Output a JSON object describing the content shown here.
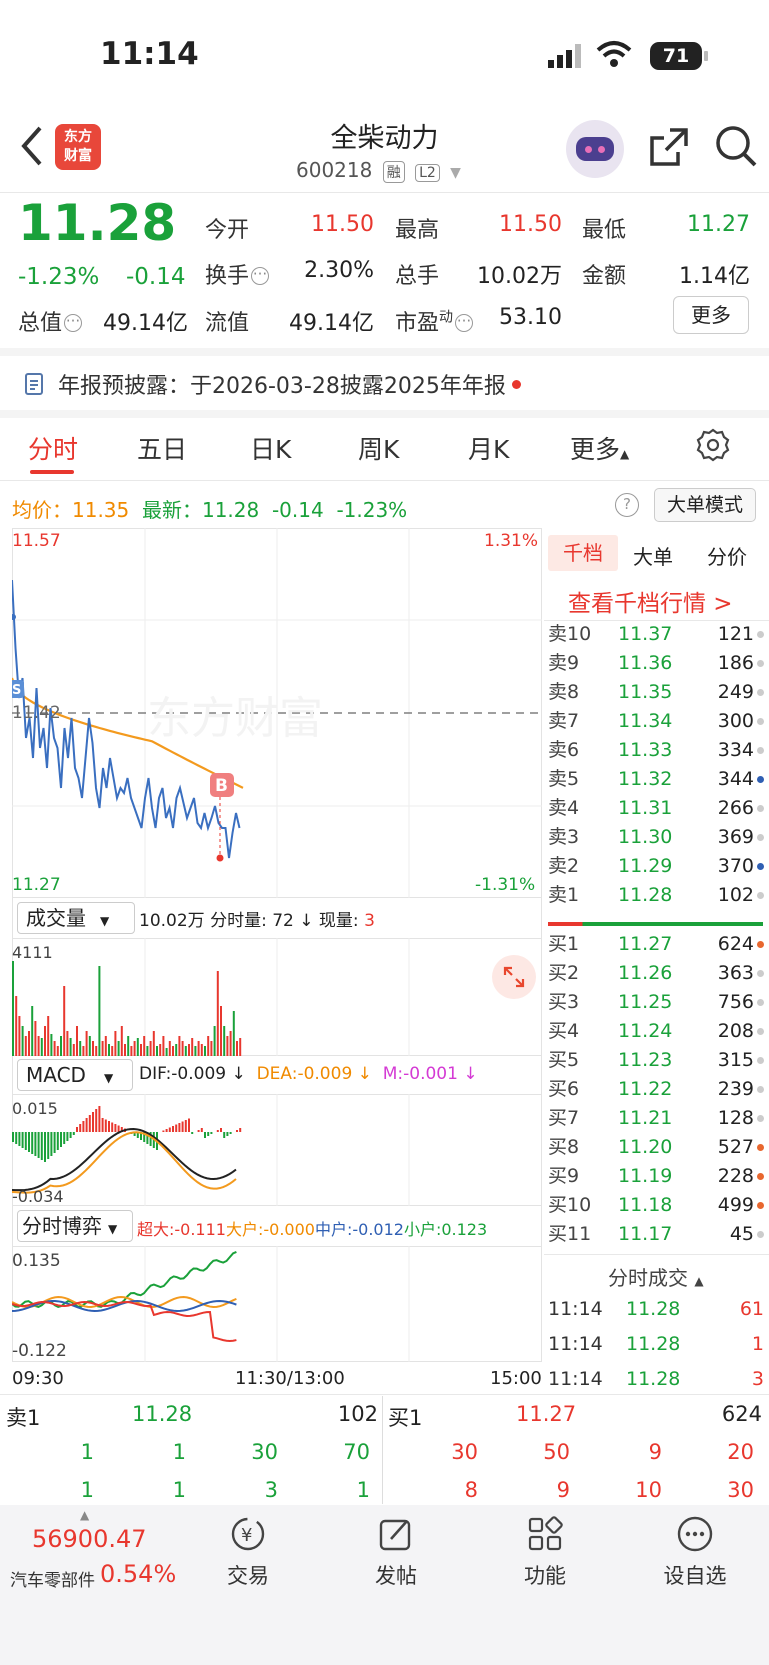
{
  "status": {
    "time": "11:14",
    "battery": "71"
  },
  "header": {
    "title": "全柴动力",
    "code": "600218",
    "tag1": "融",
    "tag2": "L2",
    "logo_line1": "东方",
    "logo_line2": "财富"
  },
  "quote": {
    "price": "11.28",
    "pct": "-1.23%",
    "change": "-0.14",
    "open_label": "今开",
    "open": "11.50",
    "high_label": "最高",
    "high": "11.50",
    "low_label": "最低",
    "low": "11.27",
    "turnover_label": "换手",
    "turnover": "2.30%",
    "vol_label": "总手",
    "vol": "10.02万",
    "amt_label": "金额",
    "amt": "1.14亿",
    "mcap_label": "总值",
    "mcap": "49.14亿",
    "float_label": "流值",
    "float": "49.14亿",
    "pe_label": "市盈",
    "pe_sup": "动",
    "pe": "53.10",
    "more": "更多"
  },
  "notice": {
    "text": "年报预披露：于2026-03-28披露2025年年报"
  },
  "tabs": [
    "分时",
    "五日",
    "日K",
    "周K",
    "月K",
    "更多"
  ],
  "info": {
    "avg_label": "均价：",
    "avg": "11.35",
    "latest_label": "最新：",
    "latest": "11.28",
    "chg": "-0.14",
    "pct": "-1.23%",
    "mode": "大单模式"
  },
  "chart": {
    "top_price": "11.57",
    "bottom_price": "11.27",
    "ref_price": "11.42",
    "top_pct": "1.31%",
    "bottom_pct": "-1.31%",
    "watermark": "东方财富",
    "marker_b": "B",
    "marker_s": "S"
  },
  "volume": {
    "label": "成交量",
    "total": "10.02万",
    "tick_label": "分时量:",
    "tick": "72",
    "now_label": "现量:",
    "now": "3",
    "max": "4111"
  },
  "macd": {
    "label": "MACD",
    "dif": "DIF:-0.009 ↓",
    "dea": "DEA:-0.009 ↓",
    "m": "M:-0.001 ↓",
    "top": "0.015",
    "bottom": "-0.034"
  },
  "game": {
    "label": "分时博弈",
    "super": "超大:-0.111",
    "big": "大户:-0.000",
    "mid": "中户:-0.012",
    "small": "小户:0.123",
    "top": "0.135",
    "bottom": "-0.122"
  },
  "time_axis": {
    "start": "09:30",
    "mid": "11:30/13:00",
    "end": "15:00"
  },
  "orderbook": {
    "tabs": [
      "千档",
      "大单",
      "分价"
    ],
    "link": "查看千档行情 >",
    "asks": [
      {
        "l": "卖10",
        "p": "11.37",
        "v": "121"
      },
      {
        "l": "卖9",
        "p": "11.36",
        "v": "186"
      },
      {
        "l": "卖8",
        "p": "11.35",
        "v": "249"
      },
      {
        "l": "卖7",
        "p": "11.34",
        "v": "300"
      },
      {
        "l": "卖6",
        "p": "11.33",
        "v": "334"
      },
      {
        "l": "卖5",
        "p": "11.32",
        "v": "344"
      },
      {
        "l": "卖4",
        "p": "11.31",
        "v": "266"
      },
      {
        "l": "卖3",
        "p": "11.30",
        "v": "369"
      },
      {
        "l": "卖2",
        "p": "11.29",
        "v": "370"
      },
      {
        "l": "卖1",
        "p": "11.28",
        "v": "102"
      }
    ],
    "bids": [
      {
        "l": "买1",
        "p": "11.27",
        "v": "624"
      },
      {
        "l": "买2",
        "p": "11.26",
        "v": "363"
      },
      {
        "l": "买3",
        "p": "11.25",
        "v": "756"
      },
      {
        "l": "买4",
        "p": "11.24",
        "v": "208"
      },
      {
        "l": "买5",
        "p": "11.23",
        "v": "315"
      },
      {
        "l": "买6",
        "p": "11.22",
        "v": "239"
      },
      {
        "l": "买7",
        "p": "11.21",
        "v": "128"
      },
      {
        "l": "买8",
        "p": "11.20",
        "v": "527"
      },
      {
        "l": "买9",
        "p": "11.19",
        "v": "228"
      },
      {
        "l": "买10",
        "p": "11.18",
        "v": "499"
      },
      {
        "l": "买11",
        "p": "11.17",
        "v": "45"
      }
    ],
    "trades_label": "分时成交",
    "trades": [
      {
        "t": "11:14",
        "p": "11.28",
        "v": "61"
      },
      {
        "t": "11:14",
        "p": "11.28",
        "v": "1"
      },
      {
        "t": "11:14",
        "p": "11.28",
        "v": "3"
      }
    ]
  },
  "queue": {
    "sell_label": "卖1",
    "sell_price": "11.28",
    "sell_vol": "102",
    "buy_label": "买1",
    "buy_price": "11.27",
    "buy_vol": "624",
    "sell_row1": [
      "1",
      "1",
      "30",
      "70"
    ],
    "sell_row2": [
      "1",
      "1",
      "3",
      "1"
    ],
    "buy_row1": [
      "30",
      "50",
      "9",
      "20"
    ],
    "buy_row2": [
      "8",
      "9",
      "10",
      "30"
    ]
  },
  "footer": {
    "index_value": "56900.47",
    "index_name": "汽车零部件",
    "index_pct": "0.54%",
    "items": [
      "交易",
      "发帖",
      "功能",
      "设自选"
    ]
  },
  "colors": {
    "up": "#e8372e",
    "down": "#1aa13a",
    "avg": "#f39a1e",
    "line": "#3a6fc0"
  }
}
